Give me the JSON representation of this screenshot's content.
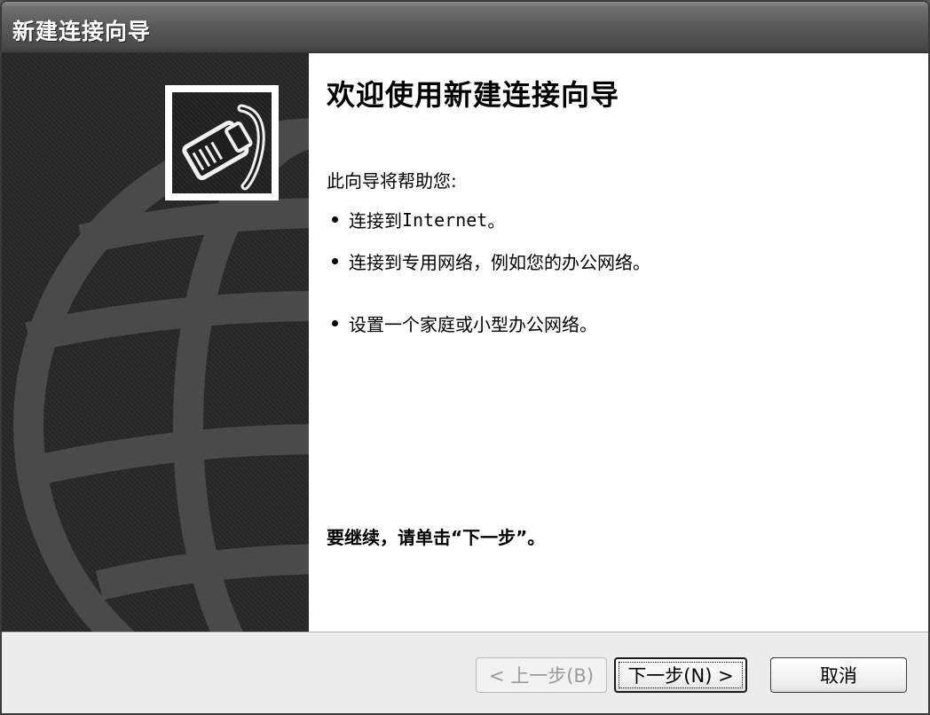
{
  "window": {
    "title": "新建连接向导"
  },
  "welcome": {
    "title": "欢迎使用新建连接向导",
    "intro": "此向导将帮助您:",
    "bullets": [
      {
        "prefix": "连接到 ",
        "mono": "Internet",
        "suffix": "。"
      },
      {
        "text": "连接到专用网络，例如您的办公网络。"
      },
      {
        "text": "设置一个家庭或小型办公网络。"
      }
    ],
    "continue_text": "要继续，请单击“下一步”。"
  },
  "buttons": {
    "back": "< 上一步(B)",
    "next": "下一步(N) >",
    "cancel": "取消"
  },
  "icons": {
    "wizard": "network-cable-icon",
    "background": "globe-icon"
  }
}
